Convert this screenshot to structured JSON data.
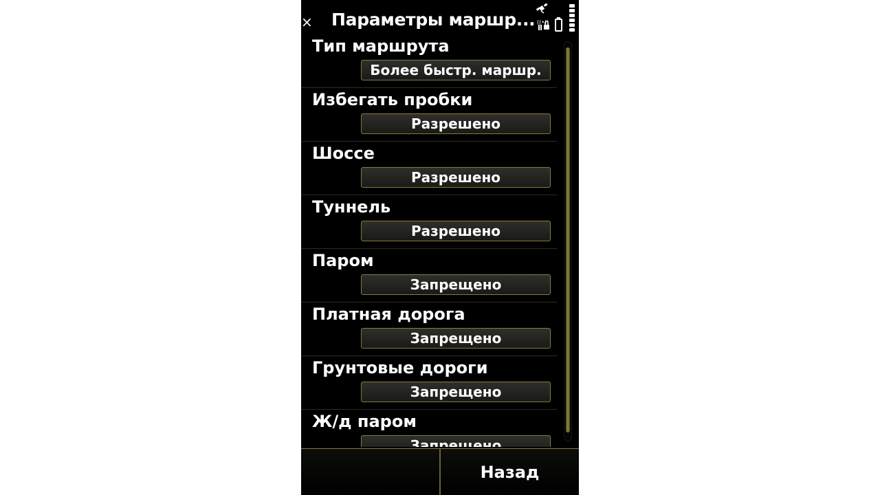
{
  "header": {
    "close_glyph": "×",
    "title": "Параметры маршр..."
  },
  "settings": [
    {
      "label": "Тип маршрута",
      "value": "Более быстр. маршр."
    },
    {
      "label": "Избегать пробки",
      "value": "Разрешено"
    },
    {
      "label": "Шоссе",
      "value": "Разрешено"
    },
    {
      "label": "Туннель",
      "value": "Разрешено"
    },
    {
      "label": "Паром",
      "value": "Запрещено"
    },
    {
      "label": "Платная дорога",
      "value": "Запрещено"
    },
    {
      "label": "Грунтовые дороги",
      "value": "Запрещено"
    },
    {
      "label": "Ж/д паром",
      "value": "Запрещено"
    }
  ],
  "softkeys": {
    "left": "",
    "right": "Назад"
  },
  "colors": {
    "background": "#000000",
    "accent": "#8a7a3a",
    "text": "#ffffff"
  }
}
